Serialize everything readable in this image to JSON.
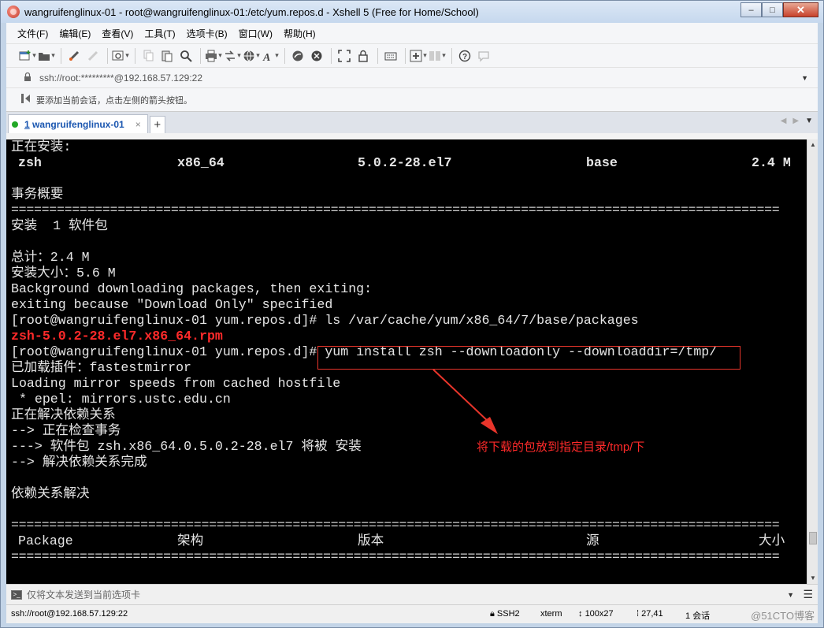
{
  "window": {
    "title": "wangruifenglinux-01 - root@wangruifenglinux-01:/etc/yum.repos.d - Xshell 5 (Free for Home/School)",
    "controls": {
      "minimize": "–",
      "maximize": "□",
      "close": "✕"
    }
  },
  "menubar": {
    "items": [
      "文件(F)",
      "编辑(E)",
      "查看(V)",
      "工具(T)",
      "选项卡(B)",
      "窗口(W)",
      "帮助(H)"
    ]
  },
  "toolbar": {
    "icons": [
      "new-session-icon",
      "open-folder-icon",
      "reconnect-icon",
      "disconnect-icon",
      "properties-icon",
      "copy-icon",
      "paste-icon",
      "find-icon",
      "print-icon",
      "transfer-icon",
      "globe-icon",
      "font-icon",
      "xftp-icon",
      "xmanager-icon",
      "fullscreen-icon",
      "lock-icon",
      "keyboard-icon",
      "add-icon",
      "layout-icon",
      "help-icon",
      "chat-icon"
    ]
  },
  "address": {
    "value": "ssh://root:*********@192.168.57.129:22"
  },
  "hint": {
    "text": "要添加当前会话，点击左侧的箭头按钮。"
  },
  "tab": {
    "number": "1",
    "label": " wangruifenglinux-01",
    "close": "×",
    "add": "+"
  },
  "terminal": {
    "installing_header": "正在安装:",
    "pkg_row": {
      "name": "zsh",
      "arch": "x86_64",
      "version": "5.0.2-28.el7",
      "repo": "base",
      "size": "2.4 M"
    },
    "summary_header": "事务概要",
    "rule": "=====================================================================================================",
    "install_line": "安装  1 软件包",
    "total_line": "总计：2.4 M",
    "install_size_line": "安装大小：5.6 M",
    "bg_line": "Background downloading packages, then exiting:",
    "exiting_line": "exiting because \"Download Only\" specified",
    "prompt1": "[root@wangruifenglinux-01 yum.repos.d]# ls /var/cache/yum/x86_64/7/base/packages",
    "rpm_file": "zsh-5.0.2-28.el7.x86_64.rpm",
    "prompt2": "[root@wangruifenglinux-01 yum.repos.d]#",
    "command": " yum install zsh --downloadonly --downloaddir=/tmp/",
    "plugins_line": "已加载插件：fastestmirror",
    "mirror_line": "Loading mirror speeds from cached hostfile",
    "epel_line": " * epel: mirrors.ustc.edu.cn",
    "resolving_line": "正在解决依赖关系",
    "checking_line": "--> 正在检查事务",
    "pkg_line": "---> 软件包 zsh.x86_64.0.5.0.2-28.el7 将被 安装",
    "resolved_line": "--> 解决依赖关系完成",
    "deps_header": "依赖关系解决",
    "table_header": {
      "package": "Package",
      "arch": "架构",
      "version": "版本",
      "repo": "源",
      "size": "大小"
    }
  },
  "annotation": {
    "text": "将下载的包放到指定目录/tmp/下",
    "color": "#ff2a2a"
  },
  "compose": {
    "placeholder": "仅将文本发送到当前选项卡"
  },
  "statusbar": {
    "connection": "ssh://root@192.168.57.129:22",
    "protocol": "SSH2",
    "terminal_type": "xterm",
    "size": "100x27",
    "cursor": "27,41",
    "sessions": "1 会话",
    "watermark": "@51CTO博客"
  }
}
